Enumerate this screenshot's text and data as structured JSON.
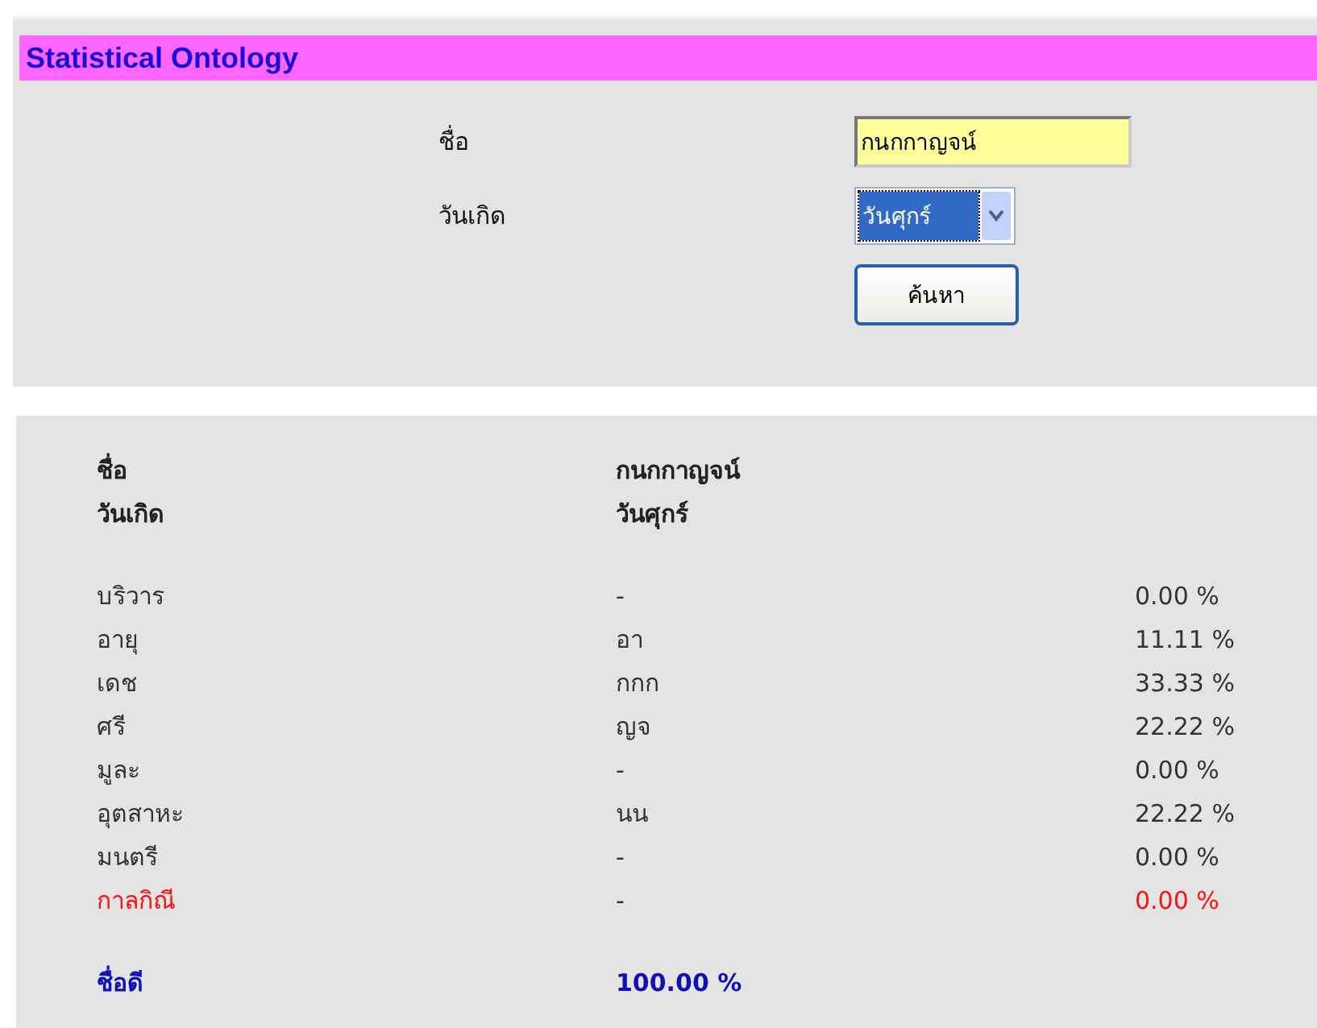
{
  "header": {
    "title": "Statistical Ontology"
  },
  "form": {
    "name_label": "ชื่อ",
    "name_value": "กนกกาญจน์",
    "day_label": "วันเกิด",
    "day_value": "วันศุกร์",
    "search_button": "ค้นหา"
  },
  "result": {
    "info": [
      {
        "label": "ชื่อ",
        "value": "กนกกาญจน์"
      },
      {
        "label": "วันเกิด",
        "value": "วันศุกร์"
      }
    ],
    "rows": [
      {
        "kind": "normal",
        "label": "บริวาร",
        "letters": "-",
        "percent": "0.00 %"
      },
      {
        "kind": "normal",
        "label": "อายุ",
        "letters": "อา",
        "percent": "11.11 %"
      },
      {
        "kind": "normal",
        "label": "เดช",
        "letters": "กกก",
        "percent": "33.33 %"
      },
      {
        "kind": "normal",
        "label": "ศรี",
        "letters": "ญจ",
        "percent": "22.22 %"
      },
      {
        "kind": "normal",
        "label": "มูละ",
        "letters": "-",
        "percent": "0.00 %"
      },
      {
        "kind": "normal",
        "label": "อุตสาหะ",
        "letters": "นน",
        "percent": "22.22 %"
      },
      {
        "kind": "normal",
        "label": "มนตรี",
        "letters": "-",
        "percent": "0.00 %"
      },
      {
        "kind": "warning",
        "label": "กาลกิณี",
        "letters": "-",
        "percent": "0.00 %"
      }
    ],
    "total": {
      "label": "ชื่อดี",
      "value": "100.00 %"
    }
  }
}
